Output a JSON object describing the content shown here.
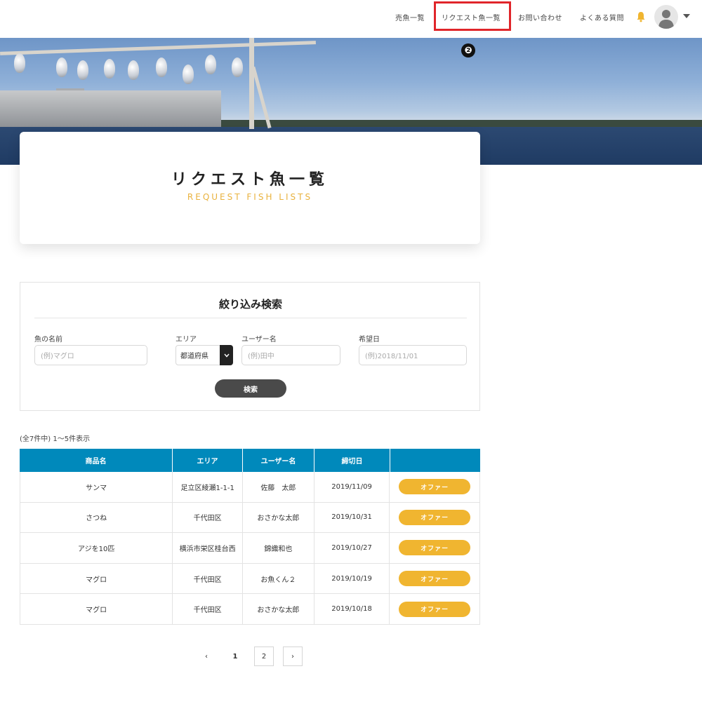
{
  "header": {
    "nav": [
      {
        "label": "売魚一覧"
      },
      {
        "label": "リクエスト魚一覧"
      },
      {
        "label": "お問い合わせ"
      },
      {
        "label": "よくある質問"
      }
    ],
    "annotation_number": "❷",
    "accent_color": "#e0252a"
  },
  "hero": {
    "title": "リクエスト魚一覧",
    "subtitle": "REQUEST FISH LISTS"
  },
  "search": {
    "title": "絞り込み検索",
    "fields": {
      "fish_name": {
        "label": "魚の名前",
        "placeholder": "(例)マグロ"
      },
      "area": {
        "label": "エリア",
        "value": "都道府県"
      },
      "user_name": {
        "label": "ユーザー名",
        "placeholder": "(例)田中"
      },
      "desired_date": {
        "label": "希望日",
        "placeholder": "(例)2018/11/01"
      }
    },
    "button_label": "検索"
  },
  "results": {
    "count_text": "(全7件中) 1～5件表示"
  },
  "table": {
    "headers": [
      "商品名",
      "エリア",
      "ユーザー名",
      "締切日",
      ""
    ],
    "rows": [
      {
        "name": "サンマ",
        "area": "足立区綾瀬1-1-1",
        "user": "佐藤　太郎",
        "deadline": "2019/11/09",
        "action": "オファー"
      },
      {
        "name": "さつね",
        "area": "千代田区",
        "user": "おさかな太郎",
        "deadline": "2019/10/31",
        "action": "オファー"
      },
      {
        "name": "アジを10匹",
        "area": "横浜市栄区桂台西",
        "user": "錦織和也",
        "deadline": "2019/10/27",
        "action": "オファー"
      },
      {
        "name": "マグロ",
        "area": "千代田区",
        "user": "お魚くん２",
        "deadline": "2019/10/19",
        "action": "オファー"
      },
      {
        "name": "マグロ",
        "area": "千代田区",
        "user": "おさかな太郎",
        "deadline": "2019/10/18",
        "action": "オファー"
      }
    ],
    "header_color": "#0089bb",
    "offer_color": "#f0b530"
  },
  "pagination": {
    "prev": "‹",
    "pages": [
      "1",
      "2"
    ],
    "next": "›"
  }
}
